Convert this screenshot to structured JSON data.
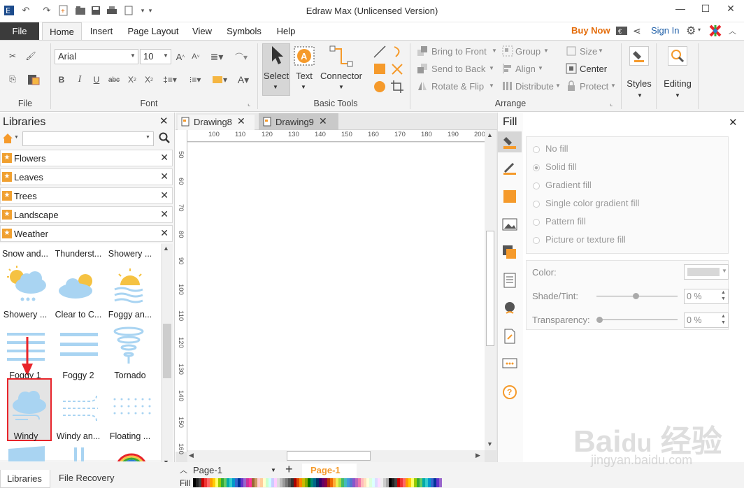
{
  "window": {
    "title": "Edraw Max (Unlicensed Version)"
  },
  "menu": {
    "file": "File",
    "tabs": [
      "Home",
      "Insert",
      "Page Layout",
      "View",
      "Symbols",
      "Help"
    ],
    "buy_now": "Buy Now",
    "sign_in": "Sign In"
  },
  "ribbon": {
    "file_group": "File",
    "font_group": "Font",
    "font_name": "Arial",
    "font_size": "10",
    "basic_tools_group": "Basic Tools",
    "select": "Select",
    "text": "Text",
    "connector": "Connector",
    "arrange_group": "Arrange",
    "bring_to_front": "Bring to Front",
    "send_to_back": "Send to Back",
    "rotate_flip": "Rotate & Flip",
    "group": "Group",
    "align": "Align",
    "distribute": "Distribute",
    "size": "Size",
    "center": "Center",
    "protect": "Protect",
    "styles": "Styles",
    "editing": "Editing"
  },
  "libraries": {
    "title": "Libraries",
    "search_placeholder": "",
    "categories": [
      "Flowers",
      "Leaves",
      "Trees",
      "Landscape",
      "Weather"
    ],
    "shapes": [
      "Snow and...",
      "Thunderst...",
      "Showery ...",
      "Showery ...",
      "Clear to C...",
      "Foggy an...",
      "Foggy 1",
      "Foggy 2",
      "Tornado",
      "Windy",
      "Windy an...",
      "Floating ..."
    ],
    "bottom_tabs": [
      "Libraries",
      "File Recovery"
    ]
  },
  "doc_tabs": [
    "Drawing8",
    "Drawing9"
  ],
  "ruler": {
    "h": [
      "100",
      "110",
      "120",
      "130",
      "140",
      "150",
      "160",
      "170",
      "180",
      "190",
      "200"
    ],
    "v": [
      "50",
      "60",
      "70",
      "80",
      "90",
      "100",
      "110",
      "120",
      "130",
      "140",
      "150",
      "160"
    ]
  },
  "page_bar": {
    "page_select": "Page-1",
    "page_tab": "Page-1",
    "fill_label": "Fill"
  },
  "fill_panel": {
    "title": "Fill",
    "options": [
      "No fill",
      "Solid fill",
      "Gradient fill",
      "Single color gradient fill",
      "Pattern fill",
      "Picture or texture fill"
    ],
    "color_label": "Color:",
    "shade_label": "Shade/Tint:",
    "shade_value": "0 %",
    "transparency_label": "Transparency:",
    "transparency_value": "0 %"
  },
  "colors": {
    "accent": "#f59a2b",
    "ribbon_bg": "#f3f3f3",
    "file_tab": "#3b3b3b",
    "buy_now": "#e46c0a",
    "sign_in": "#1f5fa8",
    "highlight": "#e8242a",
    "weather_blue": "#a9d4f2",
    "sun": "#f5c242"
  }
}
